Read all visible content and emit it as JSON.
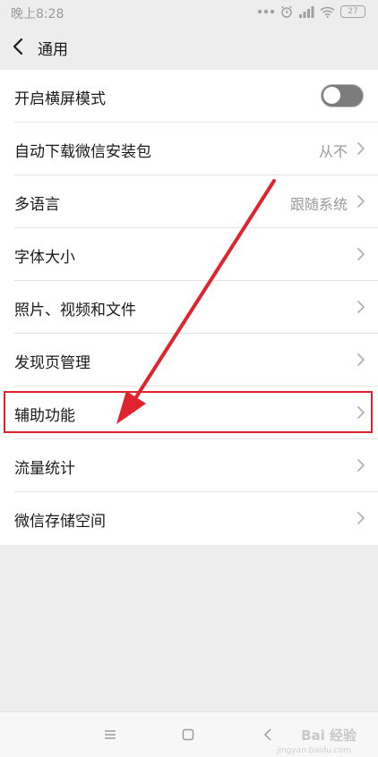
{
  "status_bar": {
    "time": "晚上8:28",
    "battery": "27"
  },
  "header": {
    "title": "通用"
  },
  "settings": {
    "items": [
      {
        "label": "开启横屏模式",
        "value": "",
        "control": "toggle",
        "toggle_on": false
      },
      {
        "label": "自动下载微信安装包",
        "value": "从不",
        "control": "chevron"
      },
      {
        "label": "多语言",
        "value": "跟随系统",
        "control": "chevron"
      },
      {
        "label": "字体大小",
        "value": "",
        "control": "chevron"
      },
      {
        "label": "照片、视频和文件",
        "value": "",
        "control": "chevron"
      },
      {
        "label": "发现页管理",
        "value": "",
        "control": "chevron"
      },
      {
        "label": "辅助功能",
        "value": "",
        "control": "chevron",
        "highlighted": true
      },
      {
        "label": "流量统计",
        "value": "",
        "control": "chevron"
      },
      {
        "label": "微信存储空间",
        "value": "",
        "control": "chevron"
      }
    ]
  },
  "annotation": {
    "color": "#e0232f",
    "shape": "arrow-and-box"
  },
  "watermark": {
    "text": "Bai 经验",
    "sub": "jingyan.baidu.com"
  },
  "system_nav": {
    "icons": [
      "menu-icon",
      "home-icon",
      "back-icon"
    ]
  }
}
